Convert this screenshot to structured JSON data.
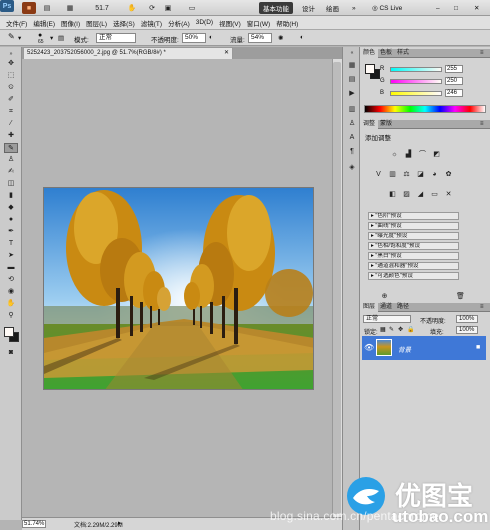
{
  "app_bar": {
    "logo": "Ps",
    "zoom_value": "51.7",
    "workspaces": [
      "基本功能",
      "设计",
      "绘画"
    ],
    "active_workspace": "基本功能",
    "cs_live": "CS Live"
  },
  "menu": [
    "文件(F)",
    "编辑(E)",
    "图像(I)",
    "图层(L)",
    "选择(S)",
    "滤镜(T)",
    "分析(A)",
    "3D(D)",
    "视图(V)",
    "窗口(W)",
    "帮助(H)"
  ],
  "options_bar": {
    "brush_size": "65",
    "mode_label": "模式:",
    "mode_value": "正常",
    "opacity_label": "不透明度:",
    "opacity_value": "50%",
    "flow_label": "流量:",
    "flow_value": "54%"
  },
  "document": {
    "tab_title": "5252423_203752056000_2.jpg @ 51.7%(RGB/8#) *"
  },
  "status": {
    "zoom": "51.74%",
    "doc_info": "文档:2.29M/2.29M"
  },
  "color_panel": {
    "tabs": [
      "颜色",
      "色板",
      "样式"
    ],
    "active_tab": "颜色",
    "channels": [
      {
        "label": "R",
        "value": "255"
      },
      {
        "label": "G",
        "value": "250"
      },
      {
        "label": "B",
        "value": "246"
      }
    ],
    "foreground": "#fffaf6",
    "background": "#1a1a1a"
  },
  "adjustments_panel": {
    "tabs": [
      "调整",
      "蒙版"
    ],
    "active_tab": "调整",
    "title": "添加调整",
    "presets": [
      "\"色阶\"预设",
      "\"曲线\"预设",
      "\"曝光度\"预设",
      "\"色相/饱和度\"预设",
      "\"黑白\"预设",
      "\"通道混和器\"预设",
      "\"可选颜色\"预设"
    ]
  },
  "layers_panel": {
    "tabs": [
      "图层",
      "通道",
      "路径"
    ],
    "active_tab": "图层",
    "blend_mode": "正常",
    "opacity_label": "不透明度:",
    "opacity_value": "100%",
    "lock_label": "锁定:",
    "fill_label": "填充:",
    "fill_value": "100%",
    "layers": [
      {
        "name": "背景",
        "selected": true
      }
    ]
  },
  "watermark": {
    "blog": "blog.sina.com.cn/pentachrome",
    "cn": "优图宝",
    "en": "utobao.com"
  },
  "colors": {
    "selection_blue": "#3f78d7",
    "brand_blue": "#2aa0e6"
  }
}
